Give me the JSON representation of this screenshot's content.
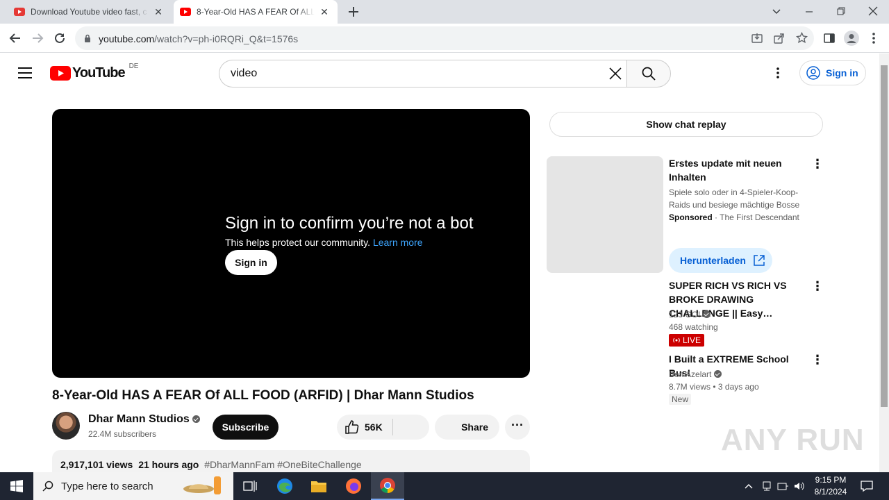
{
  "browser": {
    "tabs": [
      {
        "title": "Download Youtube video fast, c",
        "active": false
      },
      {
        "title": "8-Year-Old HAS A FEAR Of ALL F",
        "active": true
      }
    ],
    "new_tab_icon": "plus-icon",
    "url_host": "youtube.com",
    "url_path": "/watch?v=ph-i0RQRi_Q&t=1576s"
  },
  "youtube": {
    "logo_text": "YouTube",
    "region": "DE",
    "search_value": "video",
    "sign_in_label": "Sign in"
  },
  "player": {
    "title": "Sign in to confirm you’re not a bot",
    "subtitle": "This helps protect our community.",
    "learn_more": "Learn more",
    "sign_in_label": "Sign in"
  },
  "video": {
    "title": "8-Year-Old HAS A FEAR Of ALL FOOD (ARFID) | Dhar Mann Studios",
    "channel": "Dhar Mann Studios",
    "subscribers": "22.4M subscribers",
    "subscribe_label": "Subscribe",
    "likes": "56K",
    "share_label": "Share",
    "views": "2,917,101 views",
    "age": "21 hours ago",
    "hashtags": "#DharMannFam #OneBiteChallenge"
  },
  "sidebar": {
    "chat_replay_label": "Show chat replay",
    "ad": {
      "title": "Erstes update mit neuen Inhalten",
      "description": "Spiele solo oder in 4-Spieler-Koop-Raids und besiege mächtige Bosse",
      "sponsored_label": "Sponsored",
      "advertiser": "The First Descendant",
      "cta_label": "Herunterladen"
    },
    "recommendations": [
      {
        "title": "SUPER RICH VS RICH VS BROKE DRAWING CHALLENGE || Easy…",
        "channel": "123 GO!",
        "meta": "468 watching",
        "badge": "LIVE"
      },
      {
        "title": "I Built a EXTREME School Bus!",
        "channel": "Ben Azelart",
        "meta": "8.7M views",
        "meta2": "3 days ago",
        "badge": "New"
      }
    ]
  },
  "watermark": "ANY RUN",
  "taskbar": {
    "search_placeholder": "Type here to search",
    "time": "9:15 PM",
    "date": "8/1/2024"
  }
}
